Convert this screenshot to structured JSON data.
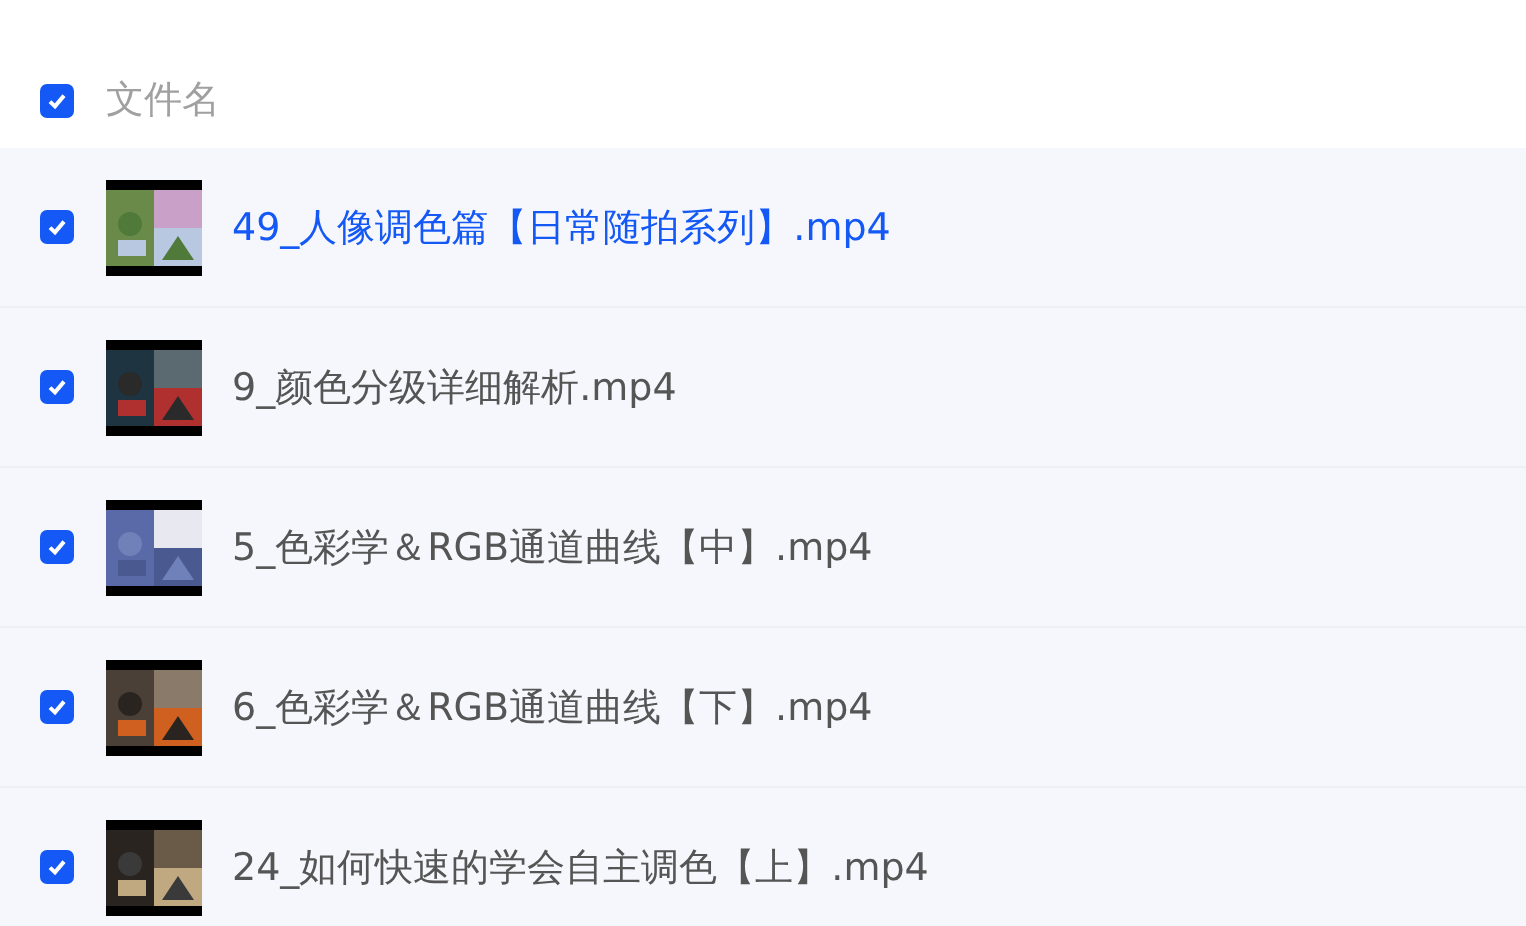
{
  "header": {
    "label": "文件名",
    "checked": true
  },
  "rows": [
    {
      "name": "49_人像调色篇【日常随拍系列】.mp4",
      "checked": true,
      "highlighted": true
    },
    {
      "name": "9_颜色分级详细解析.mp4",
      "checked": true,
      "highlighted": false
    },
    {
      "name": "5_色彩学＆RGB通道曲线【中】.mp4",
      "checked": true,
      "highlighted": false
    },
    {
      "name": "6_色彩学＆RGB通道曲线【下】.mp4",
      "checked": true,
      "highlighted": false
    },
    {
      "name": "24_如何快速的学会自主调色【上】.mp4",
      "checked": true,
      "highlighted": false
    }
  ]
}
